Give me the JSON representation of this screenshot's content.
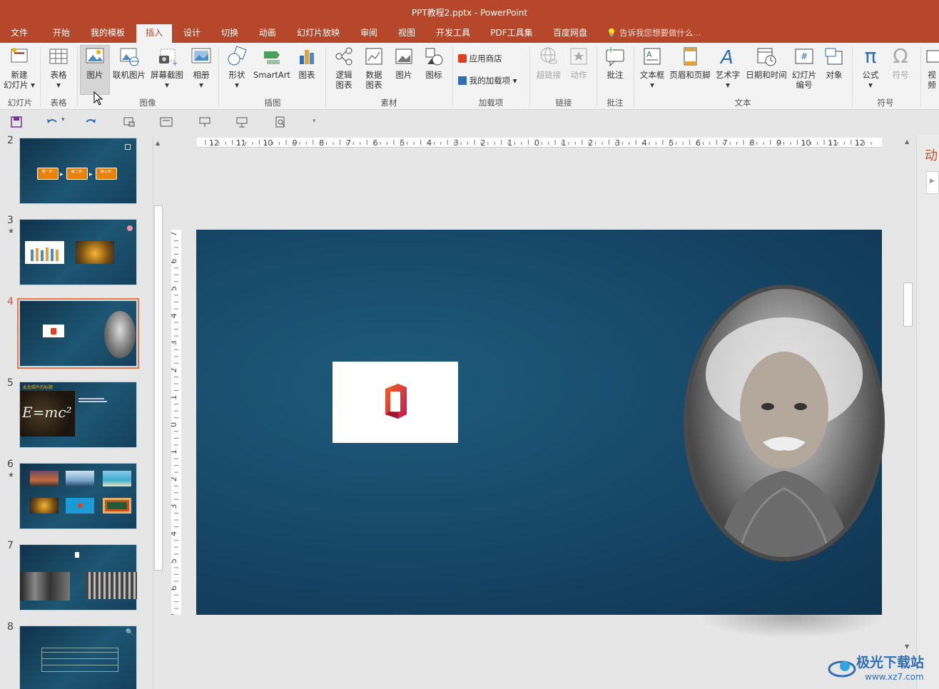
{
  "window": {
    "title": "PPT教程2.pptx - PowerPoint"
  },
  "tabs": [
    {
      "label": "文件"
    },
    {
      "label": "开始"
    },
    {
      "label": "我的模板"
    },
    {
      "label": "插入"
    },
    {
      "label": "设计"
    },
    {
      "label": "切换"
    },
    {
      "label": "动画"
    },
    {
      "label": "幻灯片放映"
    },
    {
      "label": "审阅"
    },
    {
      "label": "视图"
    },
    {
      "label": "开发工具"
    },
    {
      "label": "PDF工具集"
    },
    {
      "label": "百度网盘"
    }
  ],
  "active_tab": "插入",
  "tell_me": "告诉我您想要做什么...",
  "ribbon": {
    "new_slide_line1": "新建",
    "new_slide_line2": "幻灯片",
    "table": "表格",
    "picture": "图片",
    "online_picture": "联机图片",
    "screenshot": "屏幕截图",
    "album": "相册",
    "shapes": "形状",
    "smartart": "SmartArt",
    "chart": "图表",
    "logic_chart_1": "逻辑",
    "logic_chart_2": "图表",
    "data_chart_1": "数据",
    "data_chart_2": "图表",
    "material_picture": "图片",
    "icons": "图标",
    "store": "应用商店",
    "my_addins": "我的加载项",
    "hyperlink": "超链接",
    "action": "动作",
    "comment": "批注",
    "textbox": "文本框",
    "header_footer": "页眉和页脚",
    "wordart": "艺术字",
    "datetime": "日期和时间",
    "slide_number_1": "幻灯片",
    "slide_number_2": "编号",
    "object": "对象",
    "equation": "公式",
    "symbol": "符号",
    "video": "视频"
  },
  "groups": {
    "slides": "幻灯片",
    "tables": "表格",
    "images": "图像",
    "illustrations": "插图",
    "materials": "素材",
    "addins": "加载项",
    "links": "链接",
    "comments": "批注",
    "text": "文本",
    "symbols": "符号"
  },
  "thumbnails": [
    {
      "number": "2",
      "star": ""
    },
    {
      "number": "3",
      "star": "★"
    },
    {
      "number": "4",
      "star": ""
    },
    {
      "number": "5",
      "star": ""
    },
    {
      "number": "6",
      "star": "★"
    },
    {
      "number": "7",
      "star": ""
    },
    {
      "number": "8",
      "star": ""
    }
  ],
  "selected_slide": "4",
  "thumb_texts": {
    "s2_step1": "第一步:",
    "s2_step2": "第二步:",
    "s2_step3": "第三步:",
    "s5_title": "此处照片的标题",
    "s5_formula": "E=mc²"
  },
  "ruler_h": [
    "12",
    "11",
    "10",
    "9",
    "8",
    "7",
    "6",
    "5",
    "4",
    "3",
    "2",
    "1",
    "0",
    "1",
    "2",
    "3",
    "4",
    "5",
    "6",
    "7",
    "8",
    "9",
    "10",
    "11",
    "12"
  ],
  "ruler_v": [
    "7",
    "6",
    "5",
    "4",
    "3",
    "2",
    "1",
    "0",
    "1",
    "2",
    "3",
    "4",
    "5",
    "6",
    "7"
  ],
  "right_pane": {
    "title": "动"
  },
  "watermark": {
    "name": "极光下载站",
    "url": "www.xz7.com"
  },
  "colors": {
    "accent": "#b7472a",
    "slide_bg": "#17496a",
    "selection": "#e8794e"
  }
}
